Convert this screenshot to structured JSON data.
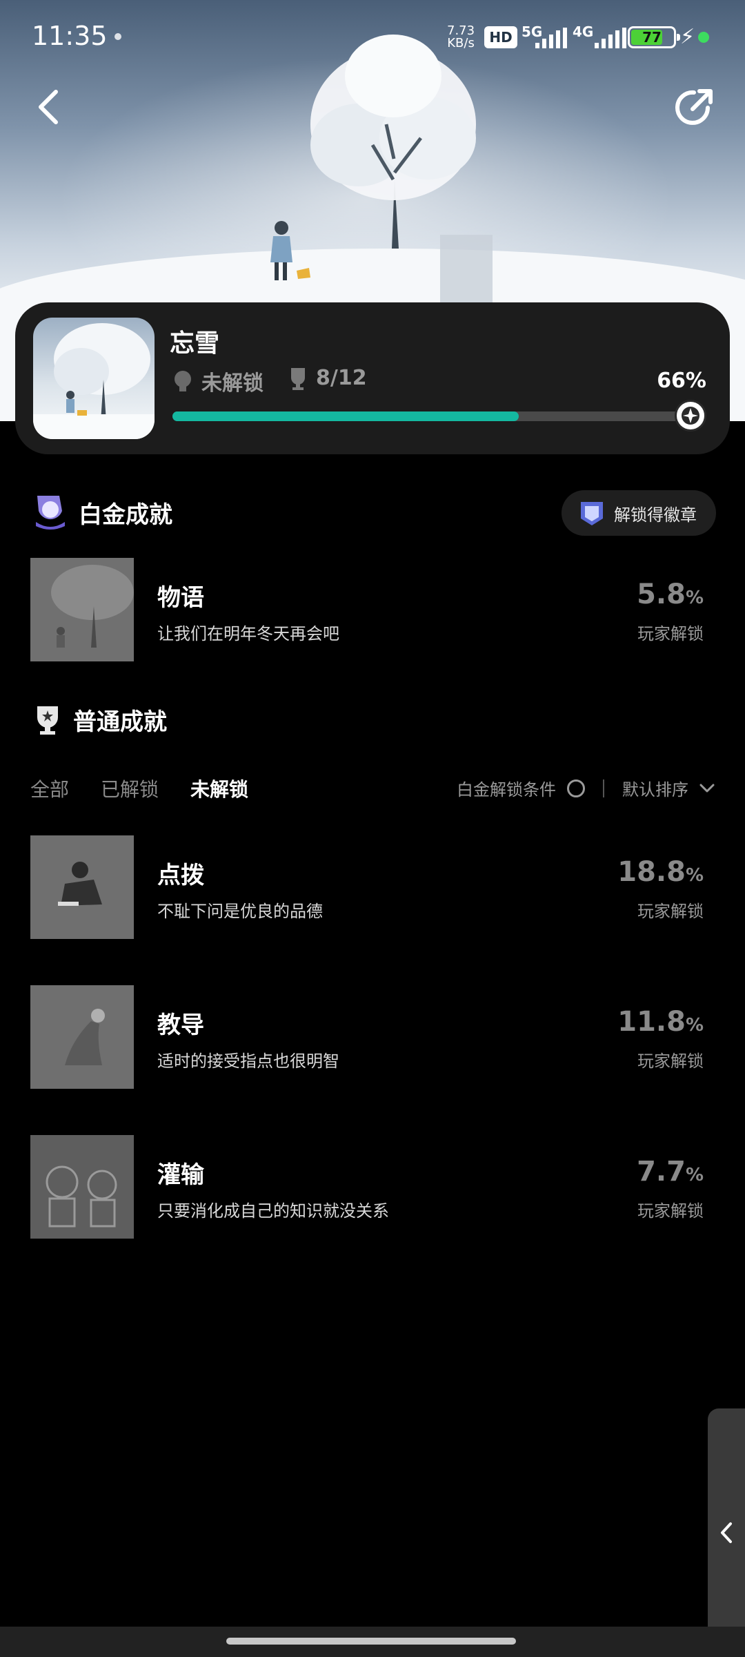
{
  "status_bar": {
    "time": "11:35",
    "net_speed_value": "7.73",
    "net_speed_unit": "KB/s",
    "hd_label": "HD",
    "net_5g": "5G",
    "net_4g": "4G",
    "battery_level": "77",
    "battery_color": "#4cd137"
  },
  "header": {
    "back_icon": "chevron-left-icon",
    "share_icon": "share-icon"
  },
  "game_card": {
    "title": "忘雪",
    "platinum_status": "未解锁",
    "trophy_count": "8/12",
    "progress_label": "66%",
    "progress_value": 0.66,
    "accent_color": "#14b8a0"
  },
  "platinum_section": {
    "title": "白金成就",
    "badge_button_label": "解锁得徽章",
    "achievement": {
      "name": "物语",
      "desc": "让我们在明年冬天再会吧",
      "rate_value": "5.8",
      "rate_unit": "%",
      "rate_label": "玩家解锁"
    }
  },
  "normal_section": {
    "title": "普通成就",
    "tabs": [
      "全部",
      "已解锁",
      "未解锁"
    ],
    "active_tab": "未解锁",
    "condition_filter_label": "白金解锁条件",
    "sort_label": "默认排序",
    "achievements": [
      {
        "name": "点拨",
        "desc": "不耻下问是优良的品德",
        "rate_value": "18.8",
        "rate_unit": "%",
        "rate_label": "玩家解锁"
      },
      {
        "name": "教导",
        "desc": "适时的接受指点也很明智",
        "rate_value": "11.8",
        "rate_unit": "%",
        "rate_label": "玩家解锁"
      },
      {
        "name": "灌输",
        "desc": "只要消化成自己的知识就没关系",
        "rate_value": "7.7",
        "rate_unit": "%",
        "rate_label": "玩家解锁"
      }
    ]
  }
}
